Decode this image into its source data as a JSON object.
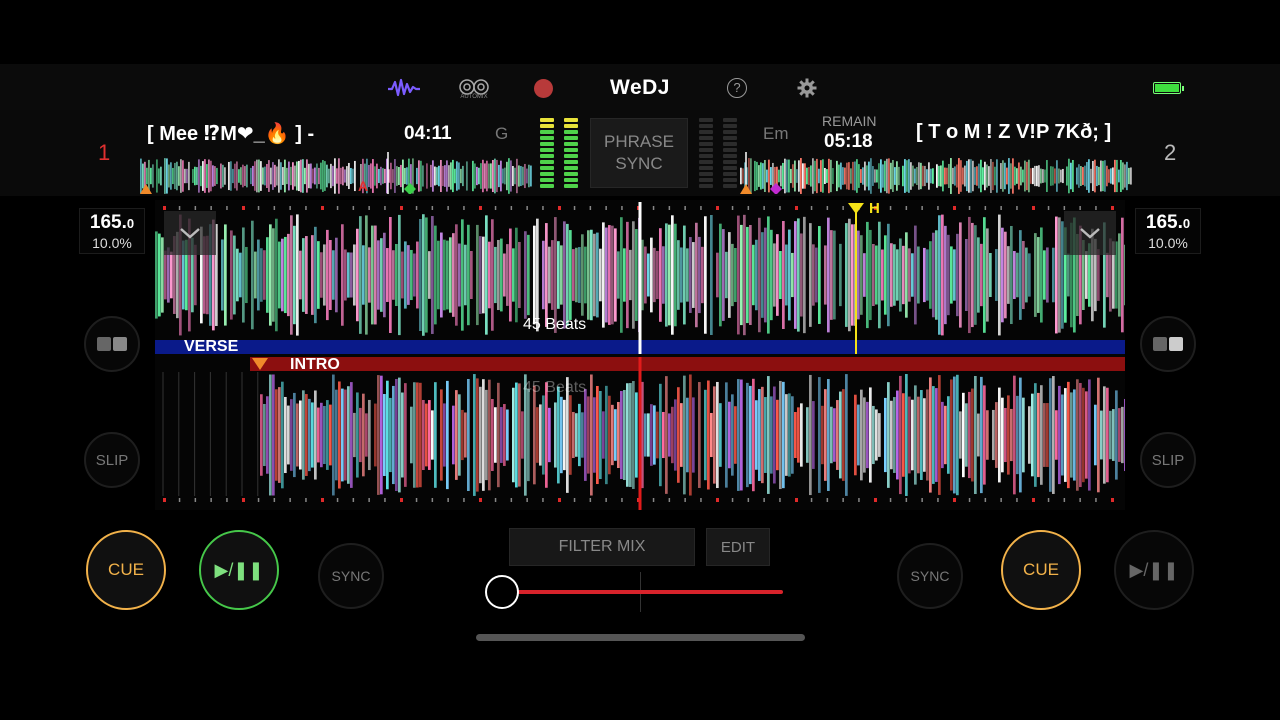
{
  "app": {
    "brand": "WeDJ",
    "automix_label": "AUTOMIX"
  },
  "toolbar": {
    "icons": [
      "waveform-icon",
      "automix-icon",
      "record-icon",
      "help-icon",
      "gear-icon",
      "battery-icon"
    ]
  },
  "deck1": {
    "number": "1",
    "title": "[ Mee ⁉M❤_🔥 ] -",
    "time": "04:11",
    "key": "G",
    "bpm": "165.",
    "bpm_decimal": "0",
    "pitch": "10.0%",
    "beats_label": "45 Beats",
    "phrase_label": "VERSE",
    "buttons": {
      "cue": "CUE",
      "play": "▶/❚❚",
      "sync": "SYNC",
      "slip": "SLIP"
    }
  },
  "deck2": {
    "number": "2",
    "title": "[ T o M ! Z V!P 7Kð; ]",
    "remain_label": "REMAIN",
    "time": "05:18",
    "key": "Em",
    "bpm": "165.",
    "bpm_decimal": "0",
    "pitch": "10.0%",
    "beats_label": "45 Beats",
    "phrase_label": "INTRO",
    "hotcue": "H",
    "overview_marker": "A",
    "buttons": {
      "cue": "CUE",
      "play": "▶/❚❚",
      "sync": "SYNC",
      "slip": "SLIP"
    }
  },
  "center": {
    "phrase_sync": [
      "PHRASE",
      "SYNC"
    ],
    "filter_mix": "FILTER MIX",
    "edit": "EDIT",
    "crossfader_value": 0
  },
  "colors": {
    "cue": "#f2b24a",
    "play": "#46c84a",
    "verse_bar": "#0a1a8a",
    "intro_bar": "#8c0f0f",
    "playhead2": "#e21b1b",
    "hotcue": "#f5e318"
  }
}
